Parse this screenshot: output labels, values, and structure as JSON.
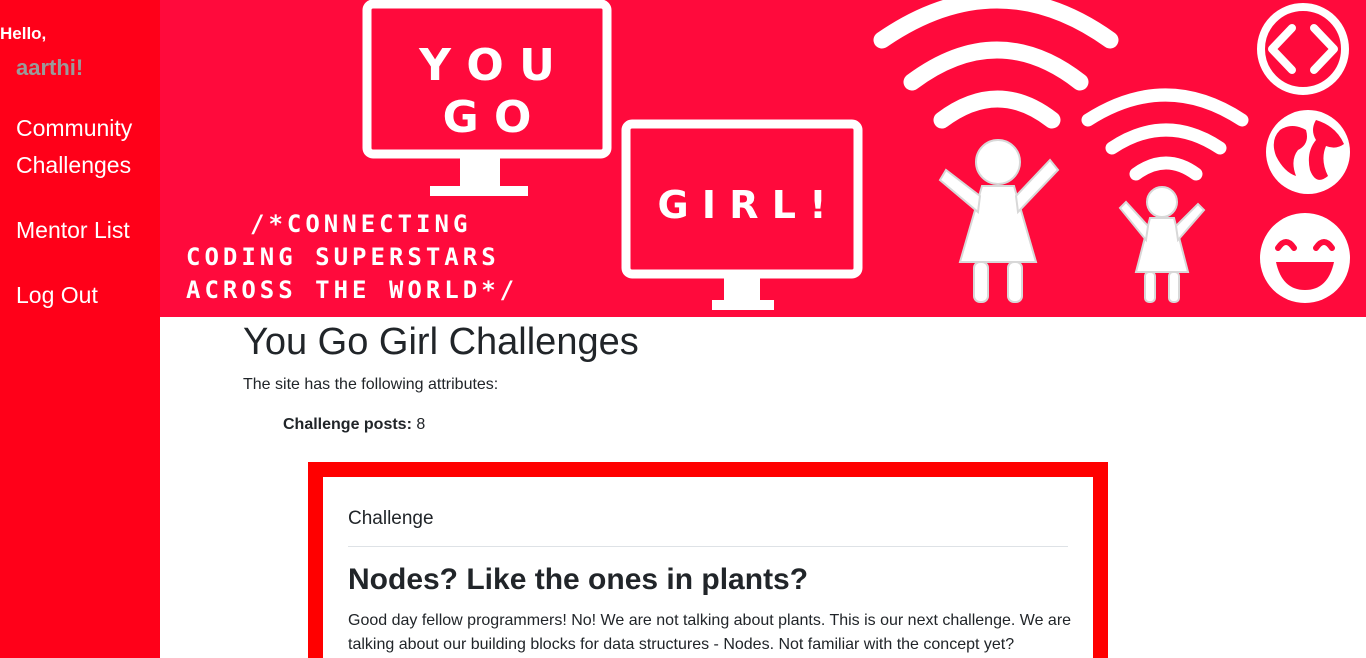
{
  "sidebar": {
    "greeting": "Hello,",
    "username": "aarthi!",
    "nav": {
      "community": "Community Challenges",
      "mentors": "Mentor List",
      "logout": "Log Out"
    }
  },
  "banner": {
    "monitor1_line1": "Y O U",
    "monitor1_line2": "G O",
    "monitor2": "G I R L !",
    "tagline1": "/*CONNECTING",
    "tagline2": "CODING SUPERSTARS",
    "tagline3": "ACROSS THE WORLD*/",
    "icons": [
      "code-icon",
      "globe-icon",
      "smiley-icon",
      "wifi-icon",
      "girl-figure-icon"
    ]
  },
  "main": {
    "title": "You Go Girl Challenges",
    "intro": "The site has the following attributes:",
    "attr_label": "Challenge posts:",
    "attr_value": "8"
  },
  "card": {
    "header": "Challenge",
    "title": "Nodes? Like the ones in plants?",
    "body": "Good day fellow programmers! No! We are not talking about plants. This is our next challenge. We are talking about our building blocks for data structures - Nodes. Not familiar with the concept yet?"
  },
  "colors": {
    "sidebar": "#ff0019",
    "banner": "#ff0a3c",
    "card_frame": "#ff0000"
  }
}
